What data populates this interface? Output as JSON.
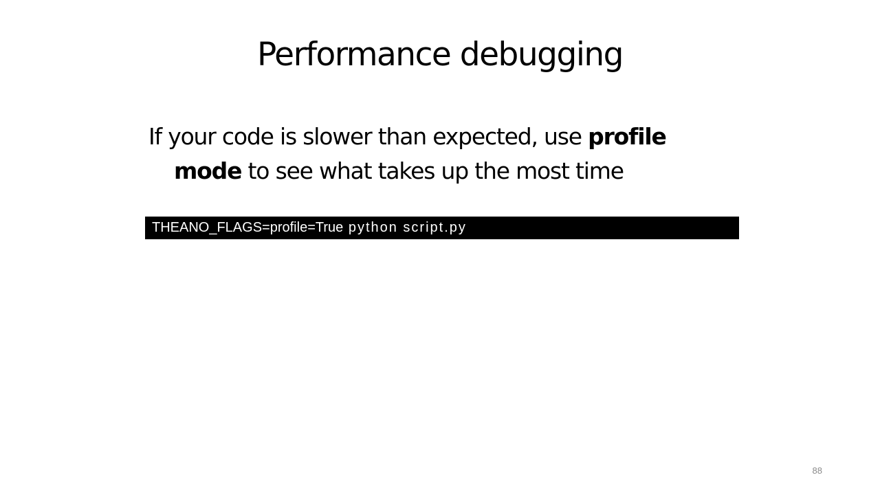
{
  "slide": {
    "title": "Performance debugging",
    "body": {
      "part1": "If your code is slower than expected, use ",
      "bold1": "profile mode",
      "part2": " to see what takes up the most time"
    },
    "code": {
      "prefix": "THEANO_FLAGS=profile=True",
      "command": " python script.py"
    },
    "page_number": "88"
  }
}
